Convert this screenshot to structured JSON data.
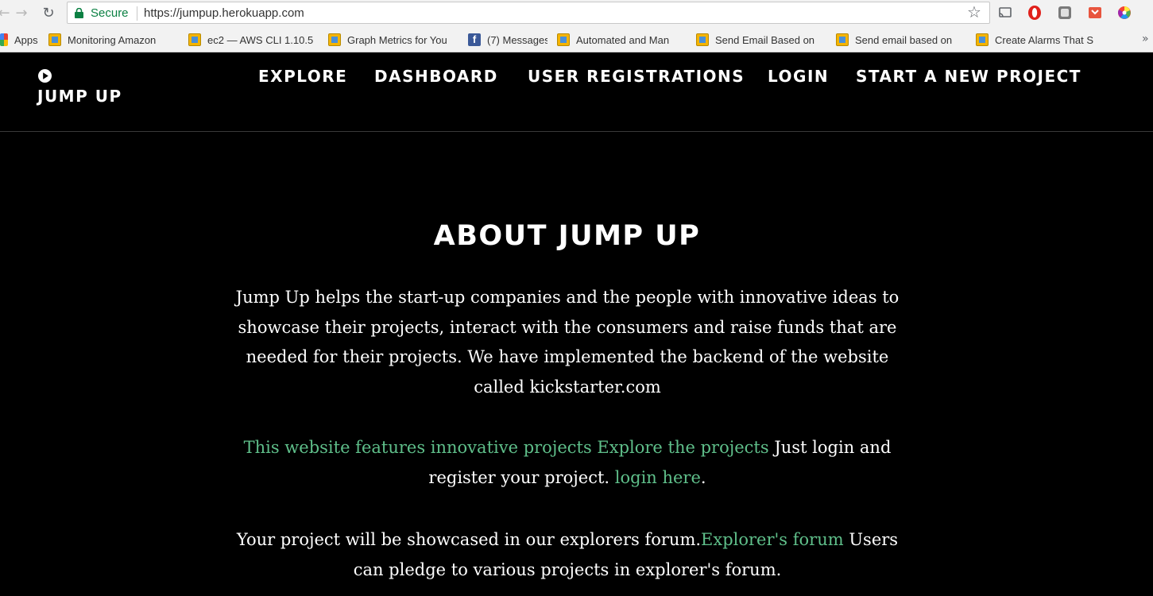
{
  "browser": {
    "secure_label": "Secure",
    "url": "https://jumpup.herokuapp.com",
    "bookmarks": [
      {
        "label": "Apps",
        "icon": "apps-icon"
      },
      {
        "label": "Monitoring Amazon",
        "icon": "aws-cube-icon"
      },
      {
        "label": "ec2 — AWS CLI 1.10.5",
        "icon": "aws-cube-icon"
      },
      {
        "label": "Graph Metrics for You",
        "icon": "aws-cube-icon"
      },
      {
        "label": "(7) Messages",
        "icon": "facebook-icon"
      },
      {
        "label": "Automated and Man",
        "icon": "aws-cube-icon"
      },
      {
        "label": "Send Email Based on",
        "icon": "aws-cube-icon"
      },
      {
        "label": "Send email based on",
        "icon": "aws-cube-icon"
      },
      {
        "label": "Create Alarms That S",
        "icon": "aws-cube-icon"
      }
    ]
  },
  "site": {
    "logo_text": "JUMP UP",
    "nav": {
      "explore": "EXPLORE",
      "dashboard": "DASHBOARD",
      "user_registrations": "USER REGISTRATIONS",
      "login": "LOGIN",
      "start_project": "START A NEW PROJECT"
    }
  },
  "about": {
    "title": "ABOUT JUMP UP",
    "intro": "Jump Up helps the start-up companies and the people with innovative ideas to showcase their projects, interact with the consumers and raise funds that are needed for their projects. We have implemented the backend of the website called kickstarter.com",
    "features_link": "This website features innovative projects",
    "explore_link": "Explore the projects",
    "login_text": "Just login and register your project.",
    "login_link": "login here",
    "period": ".",
    "forum_text": "Your project will be showcased in our explorers forum.",
    "forum_link": "Explorer's forum",
    "pledge_text": "Users can pledge to various projects in explorer's forum."
  },
  "colors": {
    "background": "#000000",
    "text": "#ffffff",
    "link": "#5fbf8a",
    "secure": "#0b8043"
  }
}
